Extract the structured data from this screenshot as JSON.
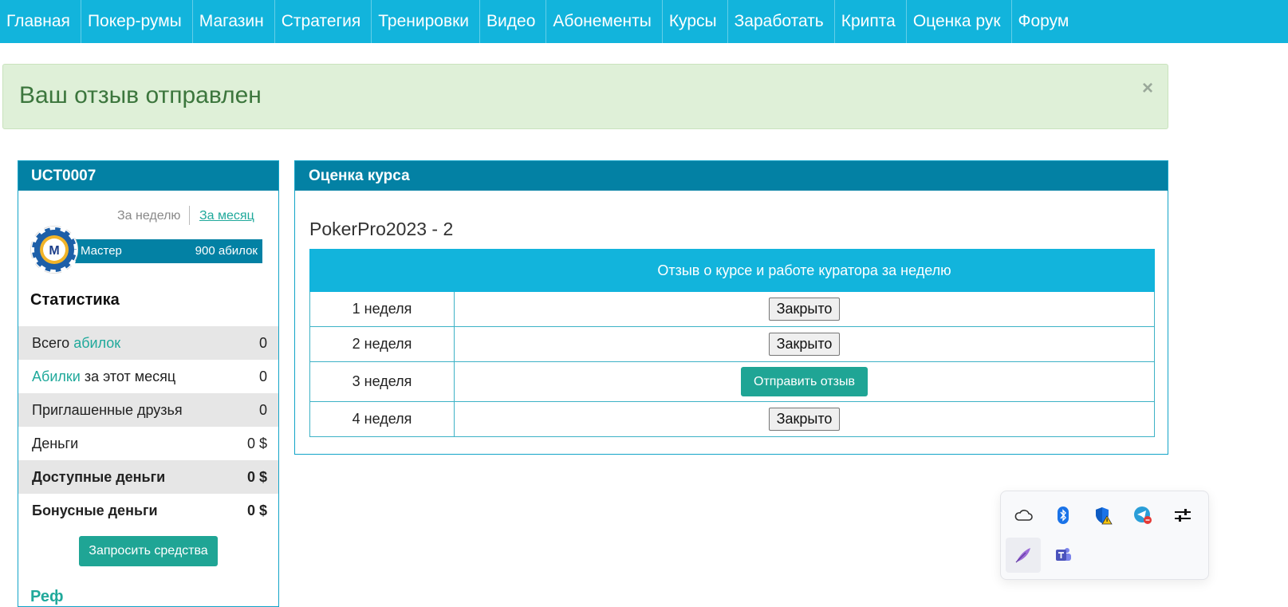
{
  "nav": {
    "items": [
      "Главная",
      "Покер-румы",
      "Магазин",
      "Стратегия",
      "Тренировки",
      "Видео",
      "Абонементы",
      "Курсы",
      "Заработать",
      "Крипта",
      "Оценка рук",
      "Форум"
    ]
  },
  "alert": {
    "message": "Ваш отзыв отправлен",
    "close": "×"
  },
  "profile": {
    "username": "UCT0007",
    "period_week": "За неделю",
    "period_month": "За месяц",
    "chip_letter": "M",
    "rank_name": "Мастер",
    "rank_points": "900 абилок",
    "stats_title": "Статистика",
    "stats": [
      {
        "label_pre": "Всего ",
        "label_link": "абилок",
        "label_post": "",
        "value": "0"
      },
      {
        "label_pre": "",
        "label_link": "Абилки",
        "label_post": " за этот месяц",
        "value": "0"
      },
      {
        "label_pre": "Приглашенные друзья",
        "label_link": "",
        "label_post": "",
        "value": "0"
      },
      {
        "label_pre": "Деньги",
        "label_link": "",
        "label_post": "",
        "value": "0 $"
      },
      {
        "label_pre": "Доступные деньги",
        "label_link": "",
        "label_post": "",
        "value": "0 $"
      },
      {
        "label_pre": "Бонусные деньги",
        "label_link": "",
        "label_post": "",
        "value": "0 $"
      }
    ],
    "request_button": "Запросить средства",
    "cut_text": "Реф"
  },
  "course": {
    "panel_title": "Оценка курса",
    "course_name": "PokerPro2023 - 2",
    "table_header": "Отзыв о курсе и работе куратора за неделю",
    "weeks": [
      {
        "label": "1 неделя",
        "action": "Закрыто",
        "state": "closed"
      },
      {
        "label": "2 неделя",
        "action": "Закрыто",
        "state": "closed"
      },
      {
        "label": "3 неделя",
        "action": "Отправить отзыв",
        "state": "open"
      },
      {
        "label": "4 неделя",
        "action": "Закрыто",
        "state": "closed"
      }
    ]
  },
  "tray": {
    "icons": [
      "onedrive-icon",
      "bluetooth-icon",
      "defender-warning-icon",
      "telegram-icon",
      "settings-sliders-icon",
      "feather-pen-icon",
      "teams-icon"
    ]
  },
  "colors": {
    "nav_bg": "#12b4dc",
    "panel_header": "#0381a4",
    "accent_teal": "#1fa595",
    "alert_bg": "#dff0d8",
    "alert_text": "#3c763d"
  }
}
